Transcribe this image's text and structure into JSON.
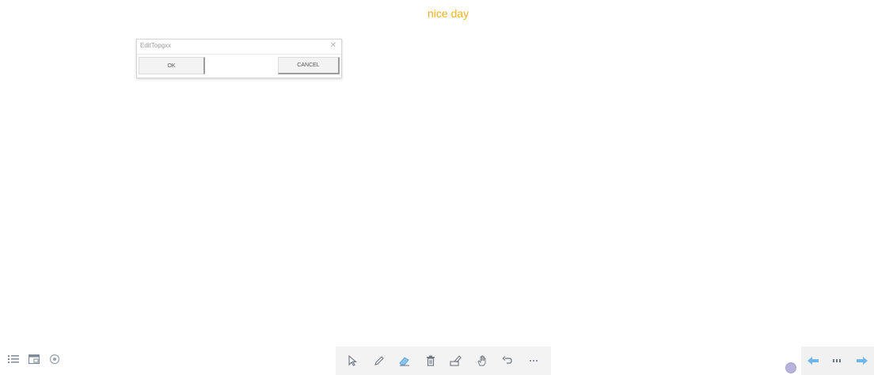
{
  "headline": {
    "text": "nice day",
    "color": "#f0b21f"
  },
  "dialog": {
    "title": "EditTopgxx",
    "close_icon": "close-icon",
    "ok_label": "OK",
    "cancel_label": "CANCEL"
  },
  "bottom_left_toolbar": {
    "icons": [
      "list-icon",
      "window-icon",
      "record-icon"
    ]
  },
  "bottom_center_toolbar": {
    "icons": [
      "pointer-icon",
      "pen-icon",
      "eraser-icon",
      "delete-icon",
      "clear-icon",
      "hand-icon",
      "undo-icon",
      "more-icon"
    ],
    "accent": "#5aa8e0"
  },
  "bottom_right_nav": {
    "icons": [
      "prev-page-icon",
      "page-counter-icon",
      "next-page-icon"
    ],
    "accent": "#6fb7ea"
  }
}
